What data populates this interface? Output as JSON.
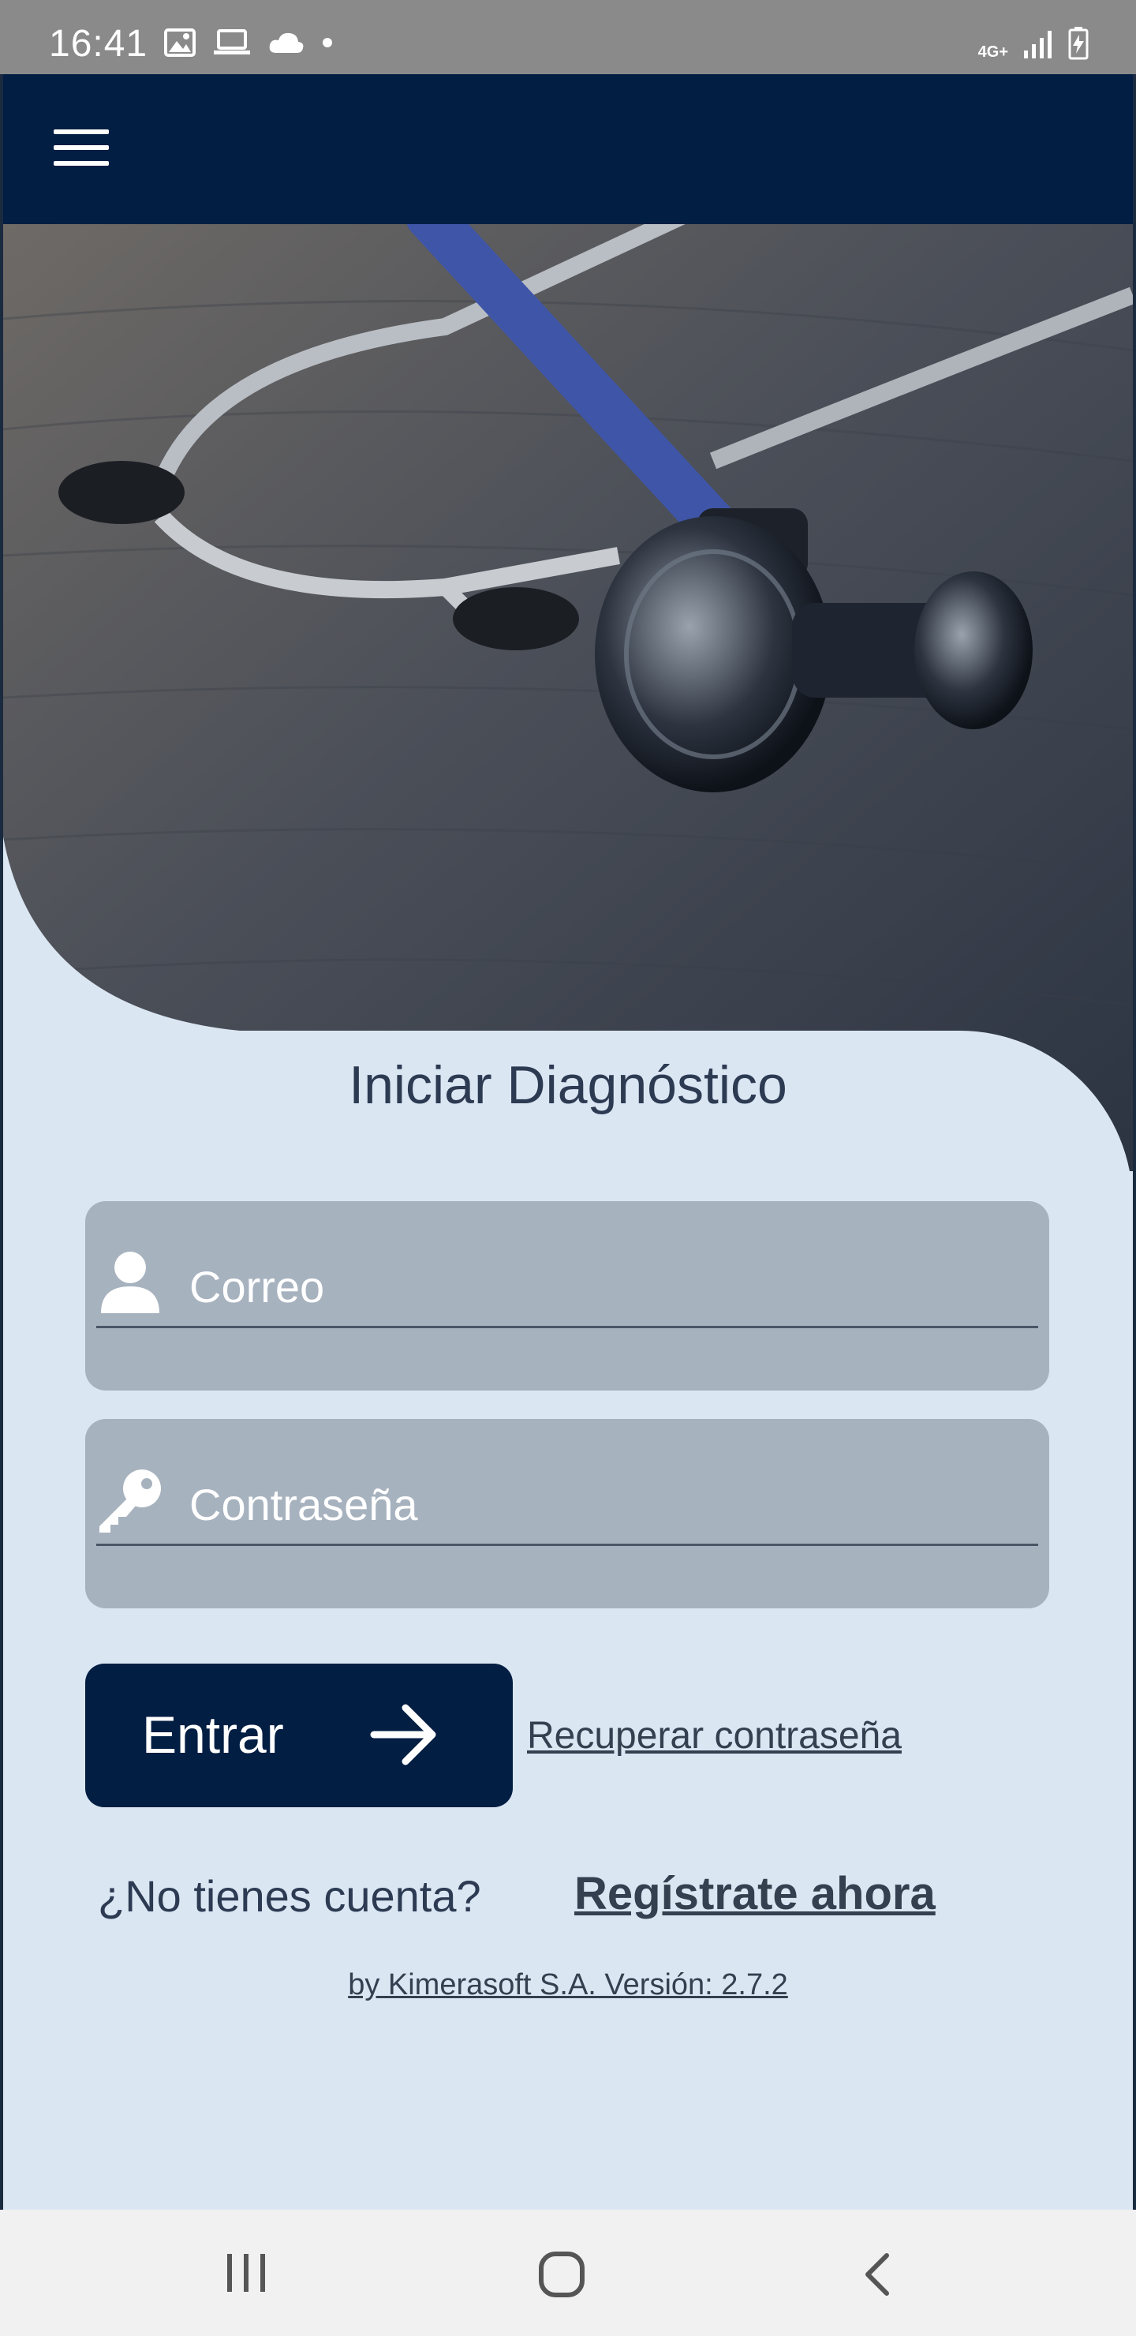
{
  "status_bar": {
    "time": "16:41",
    "network": "4G+",
    "left_icons": [
      "image-icon",
      "laptop-icon",
      "cloud-icon",
      "dot-icon"
    ],
    "right_icons": [
      "signal-icon",
      "battery-icon"
    ]
  },
  "app_bar": {
    "menu_icon": "hamburger-menu-icon"
  },
  "hero": {
    "description_icon": "stethoscope-image"
  },
  "login": {
    "title": "Iniciar Diagnóstico",
    "email_placeholder": "Correo",
    "password_placeholder": "Contraseña",
    "enter_label": "Entrar",
    "recover_label": "Recuperar contraseña",
    "no_account_text": "¿No tienes cuenta?",
    "register_label": "Regístrate ahora",
    "version_text": "by Kimerasoft S.A. Versión: 2.7.2"
  },
  "colors": {
    "app_bar": "#031e43",
    "background": "#dbe6f3",
    "field": "#a7b2bf",
    "button": "#031e43"
  }
}
